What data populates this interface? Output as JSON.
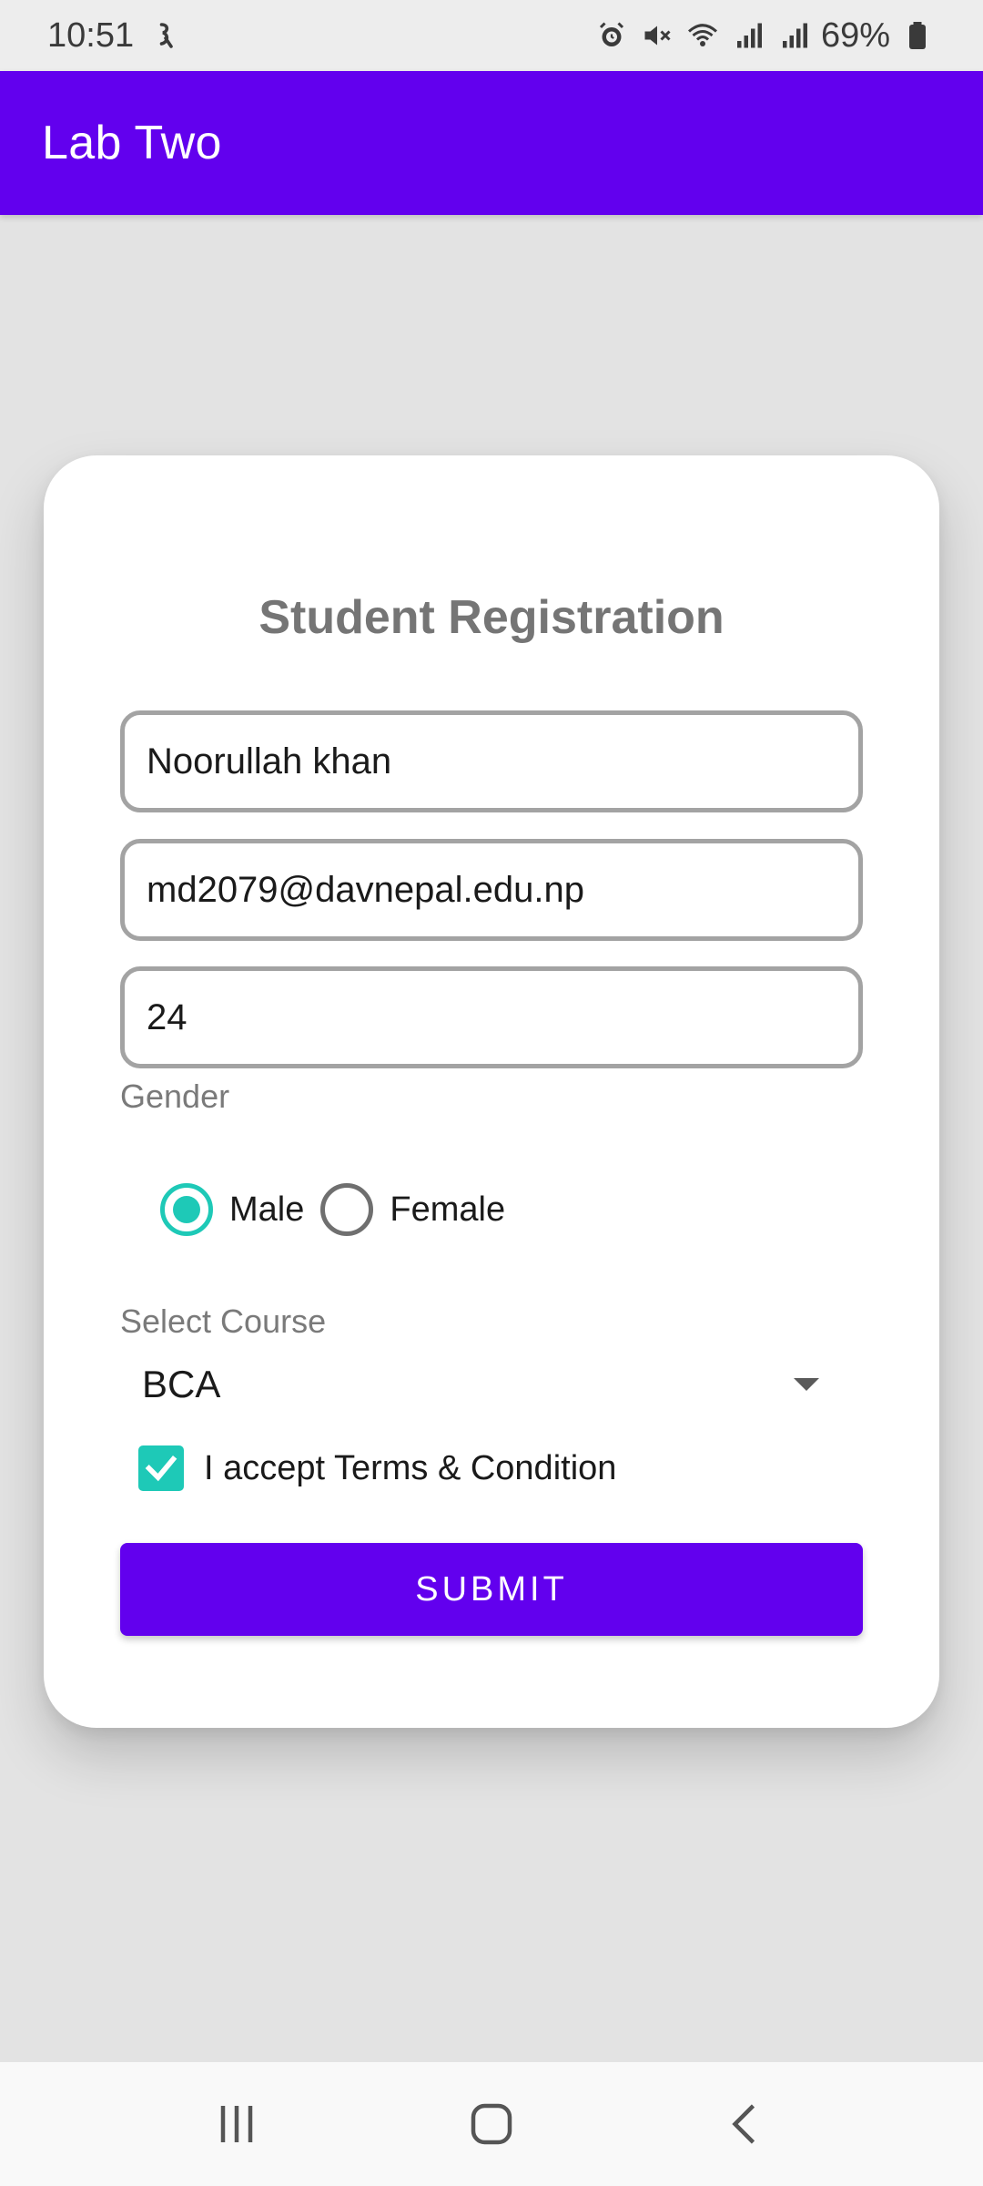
{
  "status_bar": {
    "time": "10:51",
    "battery": "69%",
    "icons": [
      "notification-icon",
      "alarm-icon",
      "mute-icon",
      "wifi-icon",
      "signal-icon",
      "signal-icon",
      "battery-icon"
    ]
  },
  "app_bar": {
    "title": "Lab Two"
  },
  "form": {
    "title": "Student Registration",
    "name_value": "Noorullah khan",
    "email_value": "md2079@davnepal.edu.np",
    "age_value": "24",
    "gender_label": "Gender",
    "gender_options": [
      {
        "label": "Male",
        "checked": true
      },
      {
        "label": "Female",
        "checked": false
      }
    ],
    "course_label": "Select Course",
    "course_value": "BCA",
    "terms_label": "I accept Terms & Condition",
    "terms_checked": true,
    "submit_label": "SUBMIT"
  },
  "nav_bar": {
    "buttons": [
      "recent-apps-icon",
      "home-icon",
      "back-icon"
    ]
  },
  "colors": {
    "primary": "#6200ee",
    "accent": "#1ec9b7",
    "background": "#e3e3e3",
    "card": "#ffffff"
  }
}
